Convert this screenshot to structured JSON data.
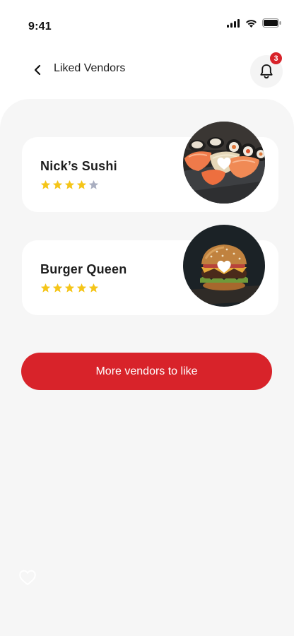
{
  "status_bar": {
    "time": "9:41"
  },
  "header": {
    "title": "Liked Vendors",
    "notification_count": "3"
  },
  "vendors": [
    {
      "name": "Nick’s Sushi",
      "rating": 4,
      "max_rating": 5,
      "photo": "sushi-photo"
    },
    {
      "name": "Burger Queen",
      "rating": 5,
      "max_rating": 5,
      "photo": "burger-photo"
    }
  ],
  "cta": {
    "label": "More vendors to like"
  },
  "colors": {
    "accent": "#d8232a",
    "star_filled": "#f5c518",
    "star_empty": "#a9aec0",
    "surface": "#f6f6f6"
  },
  "icons": [
    "back-chevron-icon",
    "bell-icon",
    "heart-icon",
    "star-icon",
    "signal-icon",
    "wifi-icon",
    "battery-icon"
  ]
}
